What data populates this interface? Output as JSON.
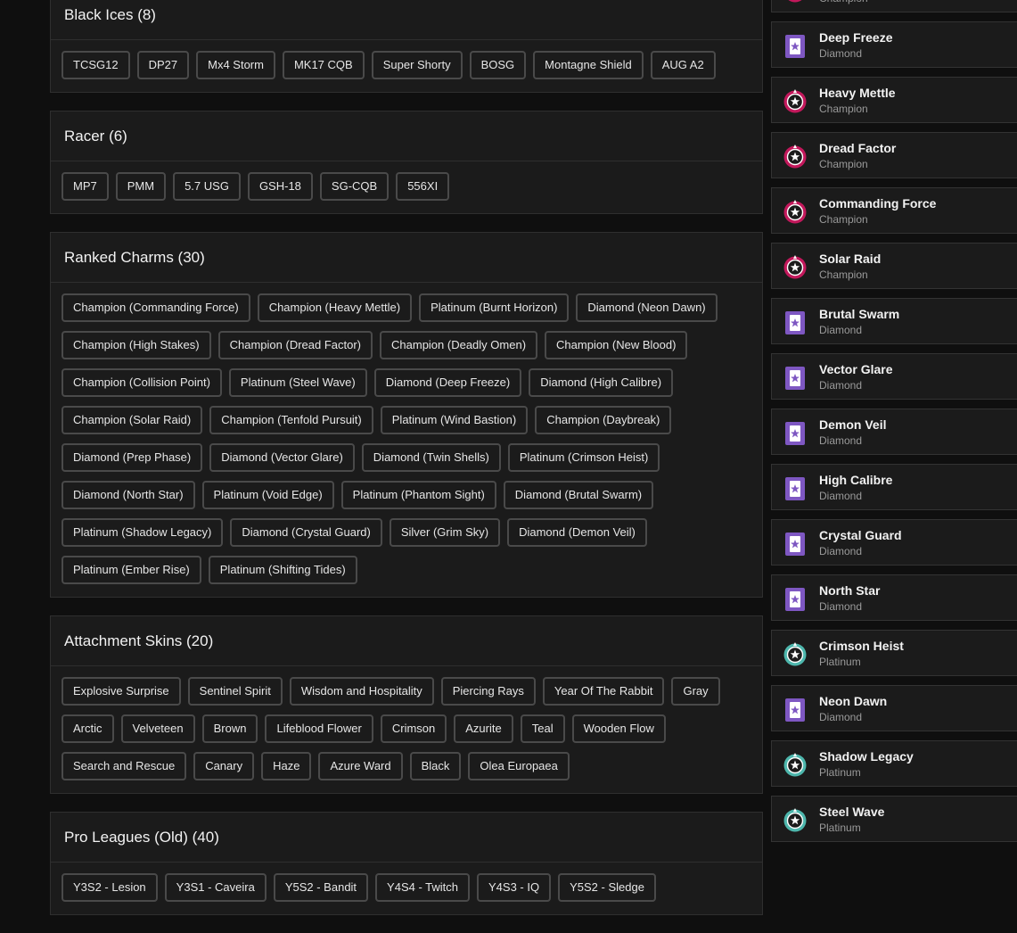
{
  "sections": [
    {
      "title": "Black Ices (8)",
      "items": [
        "TCSG12",
        "DP27",
        "Mx4 Storm",
        "MK17 CQB",
        "Super Shorty",
        "BOSG",
        "Montagne Shield",
        "AUG A2"
      ]
    },
    {
      "title": "Racer (6)",
      "items": [
        "MP7",
        "PMM",
        "5.7 USG",
        "GSH-18",
        "SG-CQB",
        "556XI"
      ]
    },
    {
      "title": "Ranked Charms (30)",
      "items": [
        "Champion (Commanding Force)",
        "Champion (Heavy Mettle)",
        "Platinum (Burnt Horizon)",
        "Diamond (Neon Dawn)",
        "Champion (High Stakes)",
        "Champion (Dread Factor)",
        "Champion (Deadly Omen)",
        "Champion (New Blood)",
        "Champion (Collision Point)",
        "Platinum (Steel Wave)",
        "Diamond (Deep Freeze)",
        "Diamond (High Calibre)",
        "Champion (Solar Raid)",
        "Champion (Tenfold Pursuit)",
        "Platinum (Wind Bastion)",
        "Champion (Daybreak)",
        "Diamond (Prep Phase)",
        "Diamond (Vector Glare)",
        "Diamond (Twin Shells)",
        "Platinum (Crimson Heist)",
        "Diamond (North Star)",
        "Platinum (Void Edge)",
        "Platinum (Phantom Sight)",
        "Diamond (Brutal Swarm)",
        "Platinum (Shadow Legacy)",
        "Diamond (Crystal Guard)",
        "Silver (Grim Sky)",
        "Diamond (Demon Veil)",
        "Platinum (Ember Rise)",
        "Platinum (Shifting Tides)"
      ]
    },
    {
      "title": "Attachment Skins (20)",
      "items": [
        "Explosive Surprise",
        "Sentinel Spirit",
        "Wisdom and Hospitality",
        "Piercing Rays",
        "Year Of The Rabbit",
        "Gray",
        "Arctic",
        "Velveteen",
        "Brown",
        "Lifeblood Flower",
        "Crimson",
        "Azurite",
        "Teal",
        "Wooden Flow",
        "Search and Rescue",
        "Canary",
        "Haze",
        "Azure Ward",
        "Black",
        "Olea Europaea"
      ]
    },
    {
      "title": "Pro Leagues (Old) (40)",
      "items": [
        "Y3S2 - Lesion",
        "Y3S1 - Caveira",
        "Y5S2 - Bandit",
        "Y4S4 - Twitch",
        "Y4S3 - IQ",
        "Y5S2 - Sledge"
      ]
    }
  ],
  "ranked_cards": [
    {
      "name": "",
      "rank": "Champion",
      "tier": "champion"
    },
    {
      "name": "Deep Freeze",
      "rank": "Diamond",
      "tier": "diamond"
    },
    {
      "name": "Heavy Mettle",
      "rank": "Champion",
      "tier": "champion"
    },
    {
      "name": "Dread Factor",
      "rank": "Champion",
      "tier": "champion"
    },
    {
      "name": "Commanding Force",
      "rank": "Champion",
      "tier": "champion"
    },
    {
      "name": "Solar Raid",
      "rank": "Champion",
      "tier": "champion"
    },
    {
      "name": "Brutal Swarm",
      "rank": "Diamond",
      "tier": "diamond"
    },
    {
      "name": "Vector Glare",
      "rank": "Diamond",
      "tier": "diamond"
    },
    {
      "name": "Demon Veil",
      "rank": "Diamond",
      "tier": "diamond"
    },
    {
      "name": "High Calibre",
      "rank": "Diamond",
      "tier": "diamond"
    },
    {
      "name": "Crystal Guard",
      "rank": "Diamond",
      "tier": "diamond"
    },
    {
      "name": "North Star",
      "rank": "Diamond",
      "tier": "diamond"
    },
    {
      "name": "Crimson Heist",
      "rank": "Platinum",
      "tier": "platinum"
    },
    {
      "name": "Neon Dawn",
      "rank": "Diamond",
      "tier": "diamond"
    },
    {
      "name": "Shadow Legacy",
      "rank": "Platinum",
      "tier": "platinum"
    },
    {
      "name": "Steel Wave",
      "rank": "Platinum",
      "tier": "platinum"
    }
  ],
  "tier_colors": {
    "champion": "#c2185b",
    "diamond": "#7e57c2",
    "platinum": "#4db6ac"
  },
  "tier_icons": {
    "champion": "champion-rank-icon",
    "diamond": "diamond-rank-icon",
    "platinum": "platinum-rank-icon"
  }
}
